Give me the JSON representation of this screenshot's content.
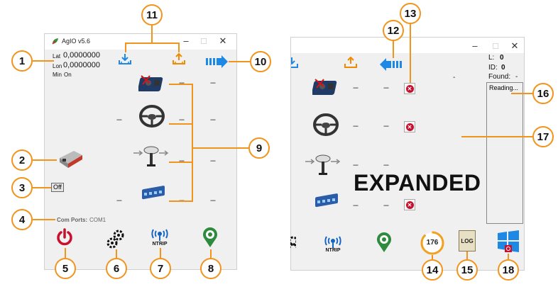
{
  "left_window": {
    "title": "AgIO v5.6",
    "lat_label": "Lat",
    "lat_value": "0,0000000",
    "lon_label": "Lon",
    "lon_value": "0,0000000",
    "min_label": "Min",
    "min_value": "On",
    "off_label": "Off",
    "com_ports_label": "Com Ports:",
    "com_ports_value": "COM1",
    "ntrip_label": "NTRIP",
    "dashes": "---"
  },
  "right_window": {
    "l_label": "L:",
    "l_value": "0",
    "id_label": "ID:",
    "id_value": "0",
    "found_label": "Found:",
    "found_value": "-",
    "reading_text": "Reading...",
    "expanded_text": "EXPANDED",
    "ntrip_label": "NTRIP",
    "gauge_value": "176",
    "log_label": "LOG"
  },
  "annotations": [
    "1",
    "2",
    "3",
    "4",
    "5",
    "6",
    "7",
    "8",
    "9",
    "10",
    "11",
    "12",
    "13",
    "14",
    "15",
    "16",
    "17",
    "18"
  ],
  "colors": {
    "annotation": "#f2941b",
    "accent_blue": "#1e88e5",
    "power_red": "#c8102e",
    "ntrip_blue": "#1565c0",
    "pin_green": "#2e8b3e"
  },
  "icons": [
    "app-leaf-icon",
    "download-icon",
    "upload-icon",
    "arrow-right-icon",
    "arrow-left-icon",
    "imu-board-icon",
    "steering-wheel-icon",
    "gps-antenna-icon",
    "machine-module-icon",
    "network-module-icon",
    "power-icon",
    "gears-icon",
    "ntrip-icon",
    "location-pin-icon",
    "gauge-icon",
    "log-icon",
    "windows-icon",
    "close-x-icon"
  ]
}
